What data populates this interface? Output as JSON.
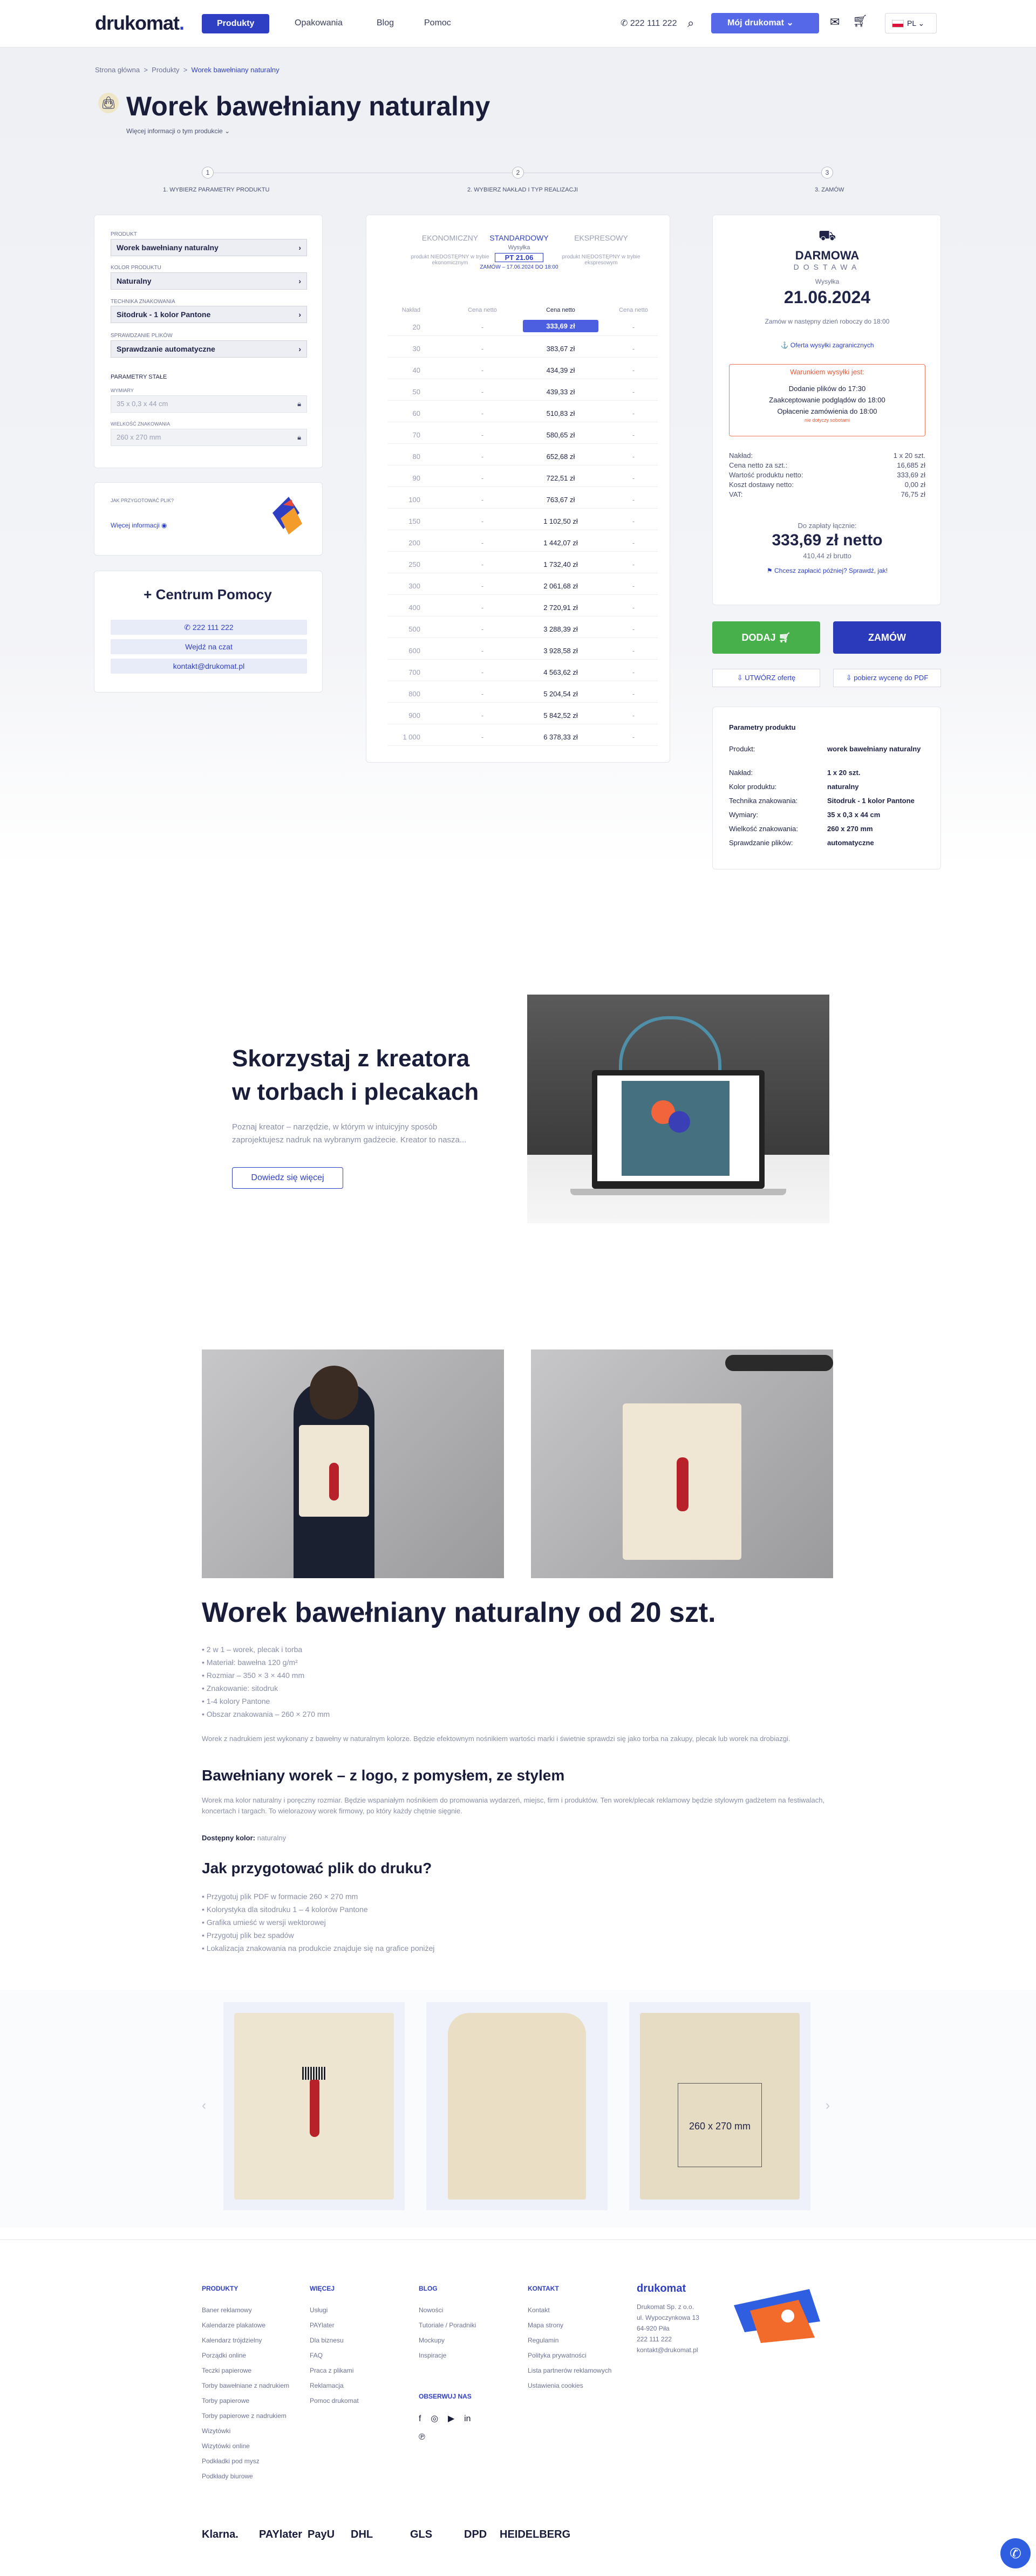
{
  "header": {
    "logo": "drukomat",
    "nav_active": "Produkty",
    "nav_links": [
      "Opakowania",
      "Blog",
      "Pomoc"
    ],
    "phone": "222 111 222",
    "account_btn": "Mój drukomat",
    "lang": "PL"
  },
  "breadcrumbs": [
    "Strona główna",
    "Produkty",
    "Worek bawełniany naturalny"
  ],
  "page_title": "Worek bawełniany naturalny",
  "more_info": "Więcej informacji o tym produkcie",
  "steps": [
    {
      "n": "1",
      "label": "1. Wybierz parametry produktu"
    },
    {
      "n": "2",
      "label": "2. Wybierz nakład i typ realizacji"
    },
    {
      "n": "3",
      "label": "3. Zamów"
    }
  ],
  "params": {
    "product_label": "PRODUKT",
    "product_value": "Worek bawełniany naturalny",
    "color_label": "KOLOR PRODUKTU",
    "color_value": "Naturalny",
    "tech_label": "TECHNIKA ZNAKOWANIA",
    "tech_value": "Sitodruk - 1 kolor Pantone",
    "check_label": "SPRAWDZANIE PLIKÓW",
    "check_value": "Sprawdzanie automatyczne",
    "fixed_label": "PARAMETRY STAŁE",
    "dim_label": "WYMIARY",
    "dim_value": "35 x 0,3 x 44 cm",
    "print_label": "WIELKOŚĆ ZNAKOWANIA",
    "print_value": "260 x 270 mm"
  },
  "prep": {
    "title": "JAK PRZYGOTOWAĆ PLIK?",
    "link": "Więcej informacji"
  },
  "help": {
    "title": "+ Centrum Pomocy",
    "phone": "222 111 222",
    "chat": "Wejdź na czat",
    "email": "kontakt@drukomat.pl"
  },
  "price_table": {
    "tabs": [
      {
        "name": "EKONOMICZNY",
        "sub": "",
        "note": "produkt NIEDOSTĘPNY w trybie ekonomicznym"
      },
      {
        "name": "STANDARDOWY",
        "sub": "Wysyłka",
        "date": "PT 21.06",
        "note": "ZAMÓW – 17.06.2024 DO 18:00"
      },
      {
        "name": "EKSPRESOWY",
        "sub": "",
        "note": "produkt NIEDOSTĘPNY w trybie ekspresowym"
      }
    ],
    "headers": [
      "Nakład",
      "Cena netto",
      "Cena netto",
      "Cena netto"
    ],
    "rows": [
      [
        "20",
        "-",
        "333,69 zł",
        "-"
      ],
      [
        "30",
        "-",
        "383,67 zł",
        "-"
      ],
      [
        "40",
        "-",
        "434,39 zł",
        "-"
      ],
      [
        "50",
        "-",
        "439,33 zł",
        "-"
      ],
      [
        "60",
        "-",
        "510,83 zł",
        "-"
      ],
      [
        "70",
        "-",
        "580,65 zł",
        "-"
      ],
      [
        "80",
        "-",
        "652,68 zł",
        "-"
      ],
      [
        "90",
        "-",
        "722,51 zł",
        "-"
      ],
      [
        "100",
        "-",
        "763,67 zł",
        "-"
      ],
      [
        "150",
        "-",
        "1 102,50 zł",
        "-"
      ],
      [
        "200",
        "-",
        "1 442,07 zł",
        "-"
      ],
      [
        "250",
        "-",
        "1 732,40 zł",
        "-"
      ],
      [
        "300",
        "-",
        "2 061,68 zł",
        "-"
      ],
      [
        "400",
        "-",
        "2 720,91 zł",
        "-"
      ],
      [
        "500",
        "-",
        "3 288,39 zł",
        "-"
      ],
      [
        "600",
        "-",
        "3 928,58 zł",
        "-"
      ],
      [
        "700",
        "-",
        "4 563,62 zł",
        "-"
      ],
      [
        "800",
        "-",
        "5 204,54 zł",
        "-"
      ],
      [
        "900",
        "-",
        "5 842,52 zł",
        "-"
      ],
      [
        "1 000",
        "-",
        "6 378,33 zł",
        "-"
      ]
    ]
  },
  "summary": {
    "free": "DARMOWA",
    "delivery": "DOSTAWA",
    "ship_label": "Wysyłka",
    "ship_date": "21.06.2024",
    "order_note": "Zamów w następny dzień roboczy do 18:00",
    "abroad": "Oferta wysyłki zagranicznych",
    "cond_title": "Warunkiem wysyłki jest:",
    "cond": [
      "Dodanie plików do 17:30",
      "Zaakceptowanie podglądów do 18:00",
      "Opłacenie zamówienia do 18:00"
    ],
    "cond_small": "nie dotyczy sobotami",
    "lines": [
      [
        "Nakład:",
        "1 x 20 szt."
      ],
      [
        "Cena netto za szt.:",
        "16,685 zł"
      ],
      [
        "Wartość produktu netto:",
        "333,69 zł"
      ],
      [
        "Koszt dostawy netto:",
        "0,00 zł"
      ],
      [
        "VAT:",
        "76,75 zł"
      ]
    ],
    "total_label": "Do zapłaty łącznie:",
    "total_net": "333,69 zł netto",
    "total_gross": "410,44 zł brutto",
    "deferred": "Chcesz zapłacić później? Sprawdź, jak!"
  },
  "actions": {
    "add": "DODAJ",
    "order": "ZAMÓW",
    "offer": "UTWÓRZ ofertę",
    "pdf": "pobierz wycenę do PDF"
  },
  "product_params": {
    "title": "Parametry produktu",
    "rows": [
      [
        "Produkt:",
        "worek bawełniany naturalny"
      ],
      [
        "Nakład:",
        "1 x 20 szt."
      ],
      [
        "Kolor produktu:",
        "naturalny"
      ],
      [
        "Technika znakowania:",
        "Sitodruk - 1 kolor Pantone"
      ],
      [
        "Wymiary:",
        "35 x 0,3 x 44 cm"
      ],
      [
        "Wielkość znakowania:",
        "260 x 270 mm"
      ],
      [
        "Sprawdzanie plików:",
        "automatyczne"
      ]
    ]
  },
  "creator": {
    "title_line1": "Skorzystaj z kreatora",
    "title_line2": "w torbach i plecakach",
    "text": "Poznaj kreator – narzędzie, w którym w intuicyjny sposób zaprojektujesz nadruk na wybranym gadżecie. Kreator to nasza...",
    "btn": "Dowiedz się więcej"
  },
  "desc": {
    "title": "Worek bawełniany naturalny od 20 szt.",
    "bullets": [
      "2 w 1 – worek, plecak i torba",
      "Materiał: bawełna 120 g/m²",
      "Rozmiar – 350 × 3 × 440 mm",
      "Znakowanie: sitodruk",
      "1-4 kolory Pantone",
      "Obszar znakowania – 260 × 270 mm"
    ],
    "p1": "Worek z nadrukiem jest wykonany z bawełny w naturalnym kolorze. Będzie efektownym nośnikiem wartości marki i świetnie sprawdzi się jako torba na zakupy, plecak lub worek na drobiazgi.",
    "h2": "Bawełniany worek – z logo, z pomysłem, ze stylem",
    "p2": "Worek ma kolor naturalny i poręczny rozmiar. Będzie wspaniałym nośnikiem do promowania wydarzeń, miejsc, firm i produktów. Ten worek/plecak reklamowy będzie stylowym gadżetem na festiwalach, koncertach i targach. To wielorazowy worek firmowy, po który każdy chętnie sięgnie.",
    "colors_label": "Dostępny kolor:",
    "colors_value": "naturalny",
    "h3": "Jak przygotować plik do druku?",
    "bullets2": [
      "Przygotuj plik PDF w formacie 260 × 270 mm",
      "Kolorystyka dla sitodruku 1 – 4 kolorów Pantone",
      "Grafika umieść w wersji wektorowej",
      "Przygotuj plik bez spadów",
      "Lokalizacja znakowania na produkcie znajduje się na grafice poniżej"
    ]
  },
  "gallery": {
    "dim_label": "260 x 270 mm"
  },
  "footer": {
    "cols": [
      {
        "title": "PRODUKTY",
        "items": [
          "Baner reklamowy",
          "Kalendarze plakatowe",
          "Kalendarz trójdzielny",
          "Porządki online",
          "Teczki papierowe",
          "Torby bawełniane z nadrukiem",
          "Torby papierowe",
          "Torby papierowe z nadrukiem",
          "Wizytówki",
          "Wizytówki online",
          "Podkładki pod mysz",
          "Podkłady biurowe"
        ]
      },
      {
        "title": "WIĘCEJ",
        "items": [
          "Usługi",
          "PAYlater",
          "Dla biznesu",
          "FAQ",
          "Praca z plikami",
          "Reklamacja",
          "Pomoc drukomat"
        ]
      },
      {
        "title": "BLOG",
        "items": [
          "Nowości",
          "Tutoriale / Poradniki",
          "Mockupy",
          "Inspiracje"
        ]
      },
      {
        "title": "KONTAKT",
        "items": [
          "Kontakt",
          "Mapa strony",
          "Regulamin",
          "Polityka prywatności",
          "Lista partnerów reklamowych",
          "Ustawienia cookies"
        ]
      }
    ],
    "social_title": "OBSERWUJ NAS",
    "company_logo": "drukomat",
    "company_lines": [
      "Drukomat Sp. z o.o.",
      "ul. Wypoczynkowa 13",
      "64-920 Piła",
      "222 111 222",
      "kontakt@drukomat.pl"
    ],
    "payments": [
      "Klarna.",
      "PAYlater",
      "PayU",
      "DHL",
      "GLS",
      "DPD",
      "HEIDELBERG"
    ]
  }
}
